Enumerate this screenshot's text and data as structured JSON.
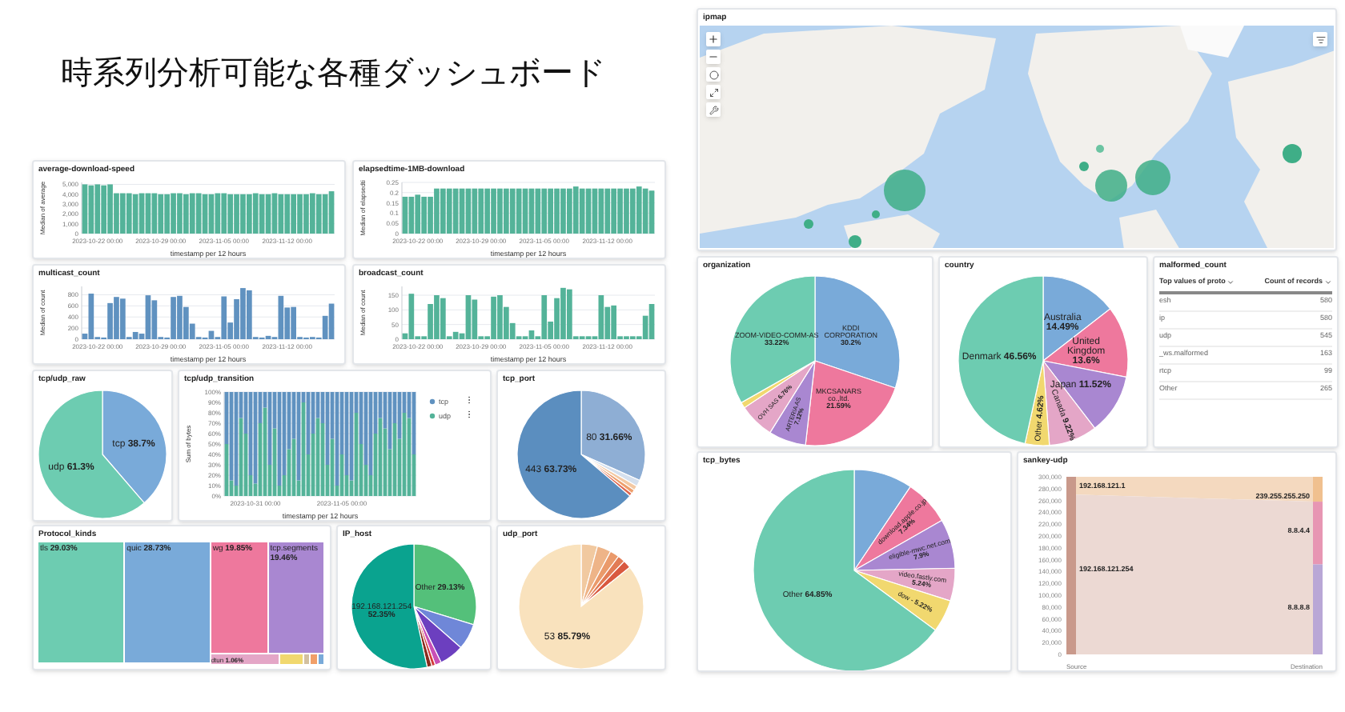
{
  "title": "時系列分析可能な各種ダッシュボード",
  "average_download_speed": {
    "title": "average-download-speed",
    "chart_data": {
      "type": "bar",
      "grid": true,
      "xlabel": "timestamp per 12 hours",
      "ylabel": "Median of average",
      "ylim": [
        0,
        5200
      ],
      "yticks": [
        0,
        {
          "value": 1000,
          "label": "1,000"
        },
        {
          "value": 2000,
          "label": "2,000"
        },
        {
          "value": 3000,
          "label": "3,000"
        },
        {
          "value": 4000,
          "label": "4,000"
        },
        {
          "value": 5000,
          "label": "5,000"
        }
      ],
      "categories": [
        null,
        null,
        "2023-10-22 00:00",
        null,
        null,
        null,
        null,
        null,
        null,
        null,
        null,
        null,
        "2023-10-29 00:00",
        null,
        null,
        null,
        null,
        null,
        null,
        null,
        null,
        null,
        "2023-11-05 00:00",
        null,
        null,
        null,
        null,
        null,
        null,
        null,
        null,
        null,
        "2023-11-12 00:00",
        null,
        null,
        null,
        null,
        null,
        null,
        null
      ],
      "series": [
        {
          "color": "#54b399",
          "values": [
            5000,
            4900,
            5000,
            4900,
            5000,
            4100,
            4100,
            4100,
            4000,
            4100,
            4100,
            4100,
            4000,
            4000,
            4100,
            4100,
            4000,
            4100,
            4100,
            4000,
            4000,
            4100,
            4100,
            4000,
            4000,
            4000,
            4000,
            4100,
            4000,
            4000,
            4100,
            4000,
            4000,
            4000,
            4000,
            4000,
            4100,
            4000,
            4000,
            4300
          ]
        }
      ]
    }
  },
  "elapsedtime_download": {
    "title": "elapsedtime-1MB-download",
    "chart_data": {
      "type": "bar",
      "grid": true,
      "xlabel": "timestamp per 12 hours",
      "ylabel": "Median of elapsedti",
      "ylim": [
        0,
        0.25
      ],
      "yticks": [
        0,
        {
          "value": 0.05,
          "label": "0.05"
        },
        {
          "value": 0.1,
          "label": "0.1"
        },
        {
          "value": 0.15,
          "label": "0.15"
        },
        {
          "value": 0.2,
          "label": "0.2"
        },
        {
          "value": 0.25,
          "label": "0.25"
        }
      ],
      "categories": [
        null,
        null,
        "2023-10-22 00:00",
        null,
        null,
        null,
        null,
        null,
        null,
        null,
        null,
        null,
        "2023-10-29 00:00",
        null,
        null,
        null,
        null,
        null,
        null,
        null,
        null,
        null,
        "2023-11-05 00:00",
        null,
        null,
        null,
        null,
        null,
        null,
        null,
        null,
        null,
        "2023-11-12 00:00",
        null,
        null,
        null,
        null,
        null,
        null,
        null
      ],
      "series": [
        {
          "color": "#54b399",
          "values": [
            0.18,
            0.18,
            0.19,
            0.18,
            0.18,
            0.22,
            0.22,
            0.22,
            0.22,
            0.22,
            0.22,
            0.22,
            0.22,
            0.22,
            0.22,
            0.22,
            0.22,
            0.22,
            0.22,
            0.22,
            0.22,
            0.22,
            0.22,
            0.22,
            0.22,
            0.22,
            0.22,
            0.23,
            0.22,
            0.22,
            0.22,
            0.22,
            0.22,
            0.22,
            0.22,
            0.22,
            0.22,
            0.23,
            0.22,
            0.21
          ]
        }
      ]
    }
  },
  "multicast_count": {
    "title": "multicast_count",
    "chart_data": {
      "type": "bar",
      "grid": true,
      "xlabel": "timestamp per 12 hours",
      "ylabel": "Median of count",
      "ylim": [
        0,
        950
      ],
      "yticks": [
        0,
        200,
        400,
        600,
        800
      ],
      "categories": [
        null,
        null,
        "2023-10-22 00:00",
        null,
        null,
        null,
        null,
        null,
        null,
        null,
        null,
        null,
        "2023-10-29 00:00",
        null,
        null,
        null,
        null,
        null,
        null,
        null,
        null,
        null,
        "2023-11-05 00:00",
        null,
        null,
        null,
        null,
        null,
        null,
        null,
        null,
        null,
        "2023-11-12 00:00",
        null,
        null,
        null,
        null,
        null,
        null,
        null
      ],
      "series": [
        {
          "color": "#6092c0",
          "values": [
            100,
            820,
            40,
            30,
            650,
            760,
            730,
            40,
            130,
            100,
            790,
            700,
            40,
            30,
            760,
            780,
            580,
            280,
            40,
            30,
            150,
            40,
            770,
            300,
            720,
            920,
            880,
            40,
            30,
            60,
            40,
            780,
            570,
            580,
            40,
            30,
            40,
            30,
            420,
            640
          ]
        }
      ]
    }
  },
  "broadcast_count": {
    "title": "broadcast_count",
    "chart_data": {
      "type": "bar",
      "grid": true,
      "xlabel": "timestamp per 12 hours",
      "ylabel": "Median of count",
      "ylim": [
        0,
        180
      ],
      "yticks": [
        0,
        50,
        100,
        150
      ],
      "categories": [
        null,
        null,
        "2023-10-22 00:00",
        null,
        null,
        null,
        null,
        null,
        null,
        null,
        null,
        null,
        "2023-10-29 00:00",
        null,
        null,
        null,
        null,
        null,
        null,
        null,
        null,
        null,
        "2023-11-05 00:00",
        null,
        null,
        null,
        null,
        null,
        null,
        null,
        null,
        null,
        "2023-11-12 00:00",
        null,
        null,
        null,
        null,
        null,
        null,
        null
      ],
      "series": [
        {
          "color": "#54b399",
          "values": [
            20,
            155,
            10,
            10,
            120,
            150,
            140,
            10,
            25,
            20,
            150,
            135,
            10,
            10,
            145,
            150,
            110,
            55,
            10,
            10,
            30,
            10,
            150,
            60,
            140,
            175,
            170,
            10,
            10,
            10,
            10,
            150,
            110,
            115,
            10,
            10,
            10,
            10,
            80,
            120
          ]
        }
      ]
    }
  },
  "tcp_udp_raw": {
    "title": "tcp/udp_raw",
    "chart_data": {
      "type": "pie",
      "categories": [
        "tcp",
        "udp"
      ],
      "values": [
        38.7,
        61.3
      ],
      "colors": [
        "#79aad9",
        "#6dccb1"
      ],
      "value_labels": [
        "38.7%",
        "61.3%"
      ]
    }
  },
  "tcp_udp_transition": {
    "title": "tcp/udp_transition",
    "chart_data": {
      "type": "bar",
      "stacked": true,
      "grid": true,
      "legend": true,
      "xlabel": "timestamp per 12 hours",
      "ylabel": "Sum of bytes",
      "ylim": [
        0,
        1
      ],
      "yticks": [
        {
          "value": 0,
          "label": "0%"
        },
        {
          "value": 0.1,
          "label": "10%"
        },
        {
          "value": 0.2,
          "label": "20%"
        },
        {
          "value": 0.3,
          "label": "30%"
        },
        {
          "value": 0.4,
          "label": "40%"
        },
        {
          "value": 0.5,
          "label": "50%"
        },
        {
          "value": 0.6,
          "label": "60%"
        },
        {
          "value": 0.7,
          "label": "70%"
        },
        {
          "value": 0.8,
          "label": "80%"
        },
        {
          "value": 0.9,
          "label": "90%"
        },
        {
          "value": 1,
          "label": "100%"
        }
      ],
      "categories": [
        null,
        null,
        null,
        null,
        null,
        null,
        "2023-10-31 00:00",
        null,
        null,
        null,
        null,
        null,
        null,
        null,
        null,
        null,
        null,
        null,
        null,
        null,
        null,
        null,
        null,
        null,
        "2023-11-05 00:00",
        null,
        null,
        null,
        null,
        null,
        null,
        null,
        null,
        null,
        null,
        null,
        null,
        null,
        null,
        null
      ],
      "series": [
        {
          "name": "tcp",
          "color": "#6092c0",
          "values": [
            0.5,
            0.85,
            0.9,
            0.25,
            0.4,
            0.8,
            0.88,
            0.3,
            0.15,
            0.7,
            0.35,
            0.9,
            0.8,
            0.55,
            0.45,
            0.85,
            0.1,
            0.6,
            0.4,
            0.25,
            0.3,
            0.7,
            0.45,
            0.9,
            0.6,
            0.8,
            0.85,
            0.2,
            0.5,
            0.7,
            0.8,
            0.4,
            0.25,
            0.35,
            0.55,
            0.3,
            0.45,
            0.2,
            0.25,
            0.6
          ]
        },
        {
          "name": "udp",
          "color": "#54b399",
          "values": [
            0.5,
            0.15,
            0.1,
            0.75,
            0.6,
            0.2,
            0.12,
            0.7,
            0.85,
            0.3,
            0.65,
            0.1,
            0.2,
            0.45,
            0.55,
            0.15,
            0.9,
            0.4,
            0.6,
            0.75,
            0.7,
            0.3,
            0.55,
            0.1,
            0.4,
            0.2,
            0.15,
            0.8,
            0.5,
            0.3,
            0.2,
            0.6,
            0.75,
            0.65,
            0.45,
            0.7,
            0.55,
            0.8,
            0.75,
            0.4
          ]
        }
      ]
    }
  },
  "tcp_port": {
    "title": "tcp_port",
    "chart_data": {
      "type": "pie",
      "categories": [
        "80",
        null,
        null,
        null,
        null,
        "443"
      ],
      "values": [
        31.66,
        1.6,
        1.2,
        1.0,
        0.81,
        63.73
      ],
      "colors": [
        "#8eaed4",
        "#d5e0ee",
        "#f3c9a4",
        "#ee9f6c",
        "#e0664f",
        "#5b8ebf"
      ],
      "value_labels": [
        "31.66%",
        null,
        null,
        null,
        null,
        "63.73%"
      ]
    }
  },
  "protocol_kinds": {
    "title": "Protocol_kinds",
    "tiles": [
      {
        "label": "tls",
        "value": "29.03%",
        "color": "#6dccb1"
      },
      {
        "label": "quic",
        "value": "28.73%",
        "color": "#79aad9"
      },
      {
        "label": "wg",
        "value": "19.85%",
        "color": "#ee789d"
      },
      {
        "label": "tcp.segments",
        "value": "19.46%",
        "color": "#a987d1"
      },
      {
        "label": "dtun",
        "value": "1.06%",
        "color": "#e4a6c7"
      }
    ],
    "small_tiles": [
      {
        "color": "#f1d86f"
      },
      {
        "color": "#d2c0a0"
      },
      {
        "color": "#f19f69"
      },
      {
        "color": "#79aad9"
      }
    ]
  },
  "ip_host": {
    "title": "IP_host",
    "chart_data": {
      "type": "pie",
      "categories": [
        "Other",
        null,
        null,
        null,
        null,
        null,
        "192.168.121.254"
      ],
      "values": [
        29.13,
        6.6,
        6.2,
        1.6,
        0.9,
        1.2,
        52.35
      ],
      "colors": [
        "#54c07a",
        "#6f87d8",
        "#6c3fbf",
        "#c94fb6",
        "#d23b3b",
        "#8a2b1e",
        "#0aa38f"
      ],
      "value_labels": [
        "29.13%",
        null,
        null,
        null,
        null,
        null,
        "52.35%"
      ]
    }
  },
  "udp_port": {
    "title": "udp_port",
    "chart_data": {
      "type": "pie",
      "categories": [
        null,
        null,
        null,
        null,
        null,
        "53"
      ],
      "values": [
        4.2,
        3.6,
        2.4,
        1.9,
        2.1,
        85.79
      ],
      "colors": [
        "#f1c9a0",
        "#eeb488",
        "#ea9a6b",
        "#e27b55",
        "#d9593f",
        "#f9e2bd"
      ],
      "value_labels": [
        null,
        null,
        null,
        null,
        null,
        "85.79%"
      ]
    }
  },
  "ipmap": {
    "title": "ipmap",
    "kind": "picture"
  },
  "organization": {
    "title": "organization",
    "chart_data": {
      "type": "pie",
      "categories": [
        "KDDI\nCORPORATION",
        "MKCSANARS\nco.,ltd.",
        "ARTERIA AS",
        "OVH SAS",
        null,
        "ZOOM-VIDEO-COMM-AS"
      ],
      "values": [
        30.2,
        21.59,
        7.12,
        6.76,
        1.11,
        33.22
      ],
      "colors": [
        "#79aad9",
        "#ee789d",
        "#a987d1",
        "#e4a6c7",
        "#f1d86f",
        "#6dccb1"
      ],
      "value_labels": [
        "30.2%",
        "21.59%",
        "7.12%",
        "6.76%",
        null,
        "33.22%"
      ]
    }
  },
  "country": {
    "title": "country",
    "chart_data": {
      "type": "pie",
      "categories": [
        "Australia",
        "United\nKingdom",
        "Japan",
        "Canada",
        "Other",
        "Denmark"
      ],
      "values": [
        14.49,
        13.6,
        11.52,
        9.22,
        4.62,
        46.56
      ],
      "colors": [
        "#79aad9",
        "#ee789d",
        "#a987d1",
        "#e4a6c7",
        "#f1d86f",
        "#6dccb1"
      ],
      "value_labels": [
        "14.49%",
        "13.6%",
        "11.52%",
        "9.22%",
        "4.62%",
        "46.56%"
      ]
    }
  },
  "malformed_count": {
    "title": "malformed_count",
    "columns": [
      "Top values of proto",
      "Count of records"
    ],
    "rows": [
      [
        "esh",
        "580"
      ],
      [
        "ip",
        "580"
      ],
      [
        "udp",
        "545"
      ],
      [
        "_ws.malformed",
        "163"
      ],
      [
        "rtcp",
        "99"
      ],
      [
        "Other",
        "265"
      ]
    ]
  },
  "tcp_bytes": {
    "title": "tcp_bytes",
    "chart_data": {
      "type": "pie",
      "categories": [
        null,
        "download.apple.co.jp",
        "eligible-mwc.net.com",
        "video.fastly.com",
        "dow -",
        "Other"
      ],
      "values": [
        9.4,
        7.34,
        7.9,
        5.24,
        5.22,
        64.85
      ],
      "colors": [
        "#79aad9",
        "#ee789d",
        "#a987d1",
        "#e4a6c7",
        "#f1d86f",
        "#6dccb1"
      ],
      "value_labels": [
        null,
        "7.34%",
        "7.9%",
        "5.24%",
        "5.22%",
        "64.85%"
      ]
    }
  },
  "sankey_udp": {
    "title": "sankey-udp",
    "yticks": [
      "300,000",
      "280,000",
      "260,000",
      "240,000",
      "220,000",
      "200,000",
      "180,000",
      "160,000",
      "140,000",
      "120,000",
      "100,000",
      "80,000",
      "60,000",
      "40,000",
      "20,000",
      "0"
    ],
    "sources": [
      "192.168.121.1",
      "192.168.121.254"
    ],
    "targets": [
      "239.255.255.250",
      "8.8.4.4",
      "8.8.8.8"
    ],
    "axis": [
      "Source",
      "Destination"
    ]
  }
}
